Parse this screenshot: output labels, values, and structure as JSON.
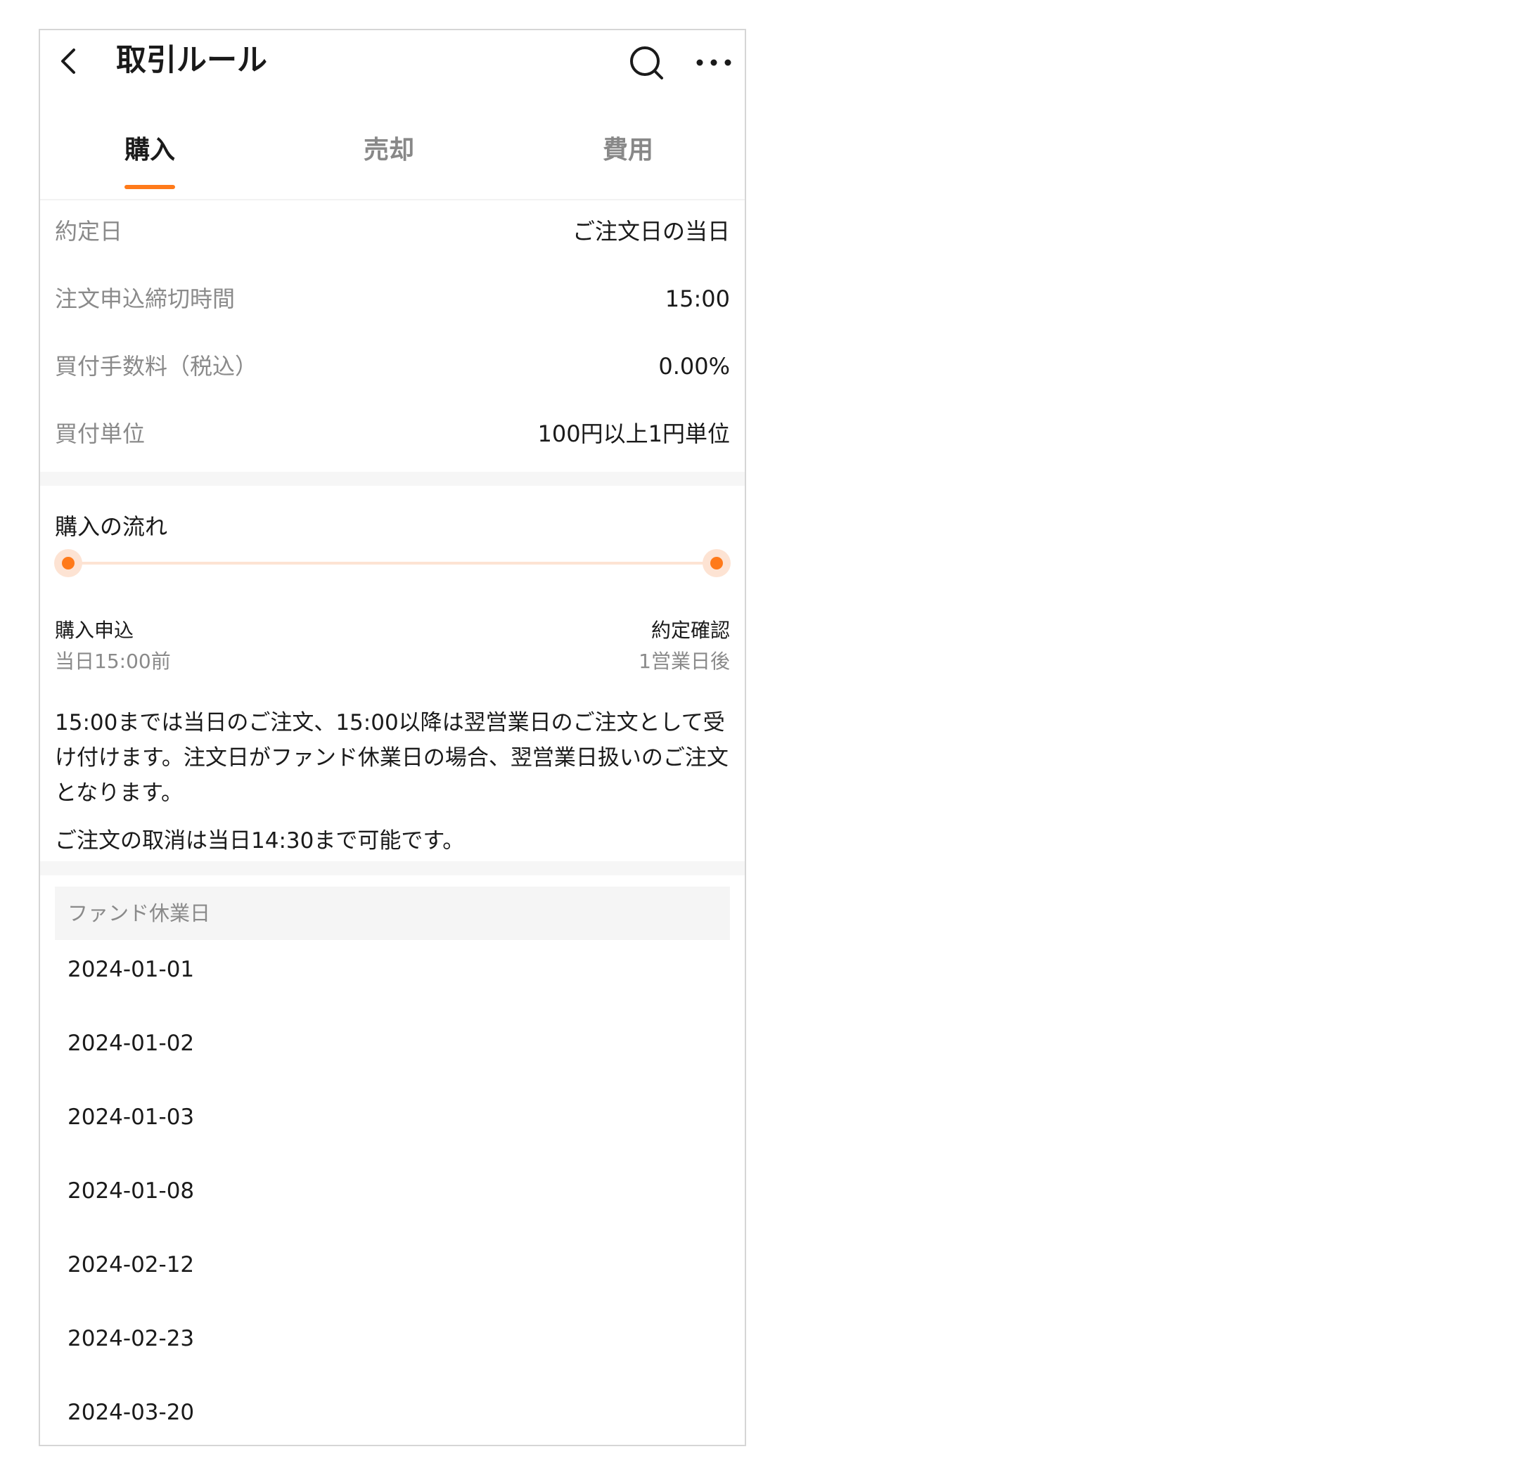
{
  "header": {
    "title": "取引ルール",
    "back_icon": "back-arrow-icon",
    "search_icon": "search-icon",
    "more_icon": "more-dots-icon"
  },
  "tabs": [
    {
      "label": "購入",
      "active": true
    },
    {
      "label": "売却",
      "active": false
    },
    {
      "label": "費用",
      "active": false
    }
  ],
  "info_rows": [
    {
      "label": "約定日",
      "value": "ご注文日の当日"
    },
    {
      "label": "注文申込締切時間",
      "value": "15:00"
    },
    {
      "label": "買付手数料（税込）",
      "value": "0.00%"
    },
    {
      "label": "買付単位",
      "value": "100円以上1円単位"
    }
  ],
  "flow": {
    "title": "購入の流れ",
    "steps": [
      {
        "name": "購入申込",
        "time": "当日15:00前"
      },
      {
        "name": "約定確認",
        "time": "1営業日後"
      }
    ],
    "notes": [
      "15:00までは当日のご注文、15:00以降は翌営業日のご注文として受け付けます。注文日がファンド休業日の場合、翌営業日扱いのご注文となります。",
      "ご注文の取消は当日14:30まで可能です。"
    ]
  },
  "holidays": {
    "header": "ファンド休業日",
    "dates": [
      "2024-01-01",
      "2024-01-02",
      "2024-01-03",
      "2024-01-08",
      "2024-02-12",
      "2024-02-23",
      "2024-03-20"
    ]
  },
  "colors": {
    "accent": "#ff7a1a",
    "accent_light": "#fde3d3",
    "muted_text": "#8a8a8a",
    "band": "#f6f6f6"
  }
}
